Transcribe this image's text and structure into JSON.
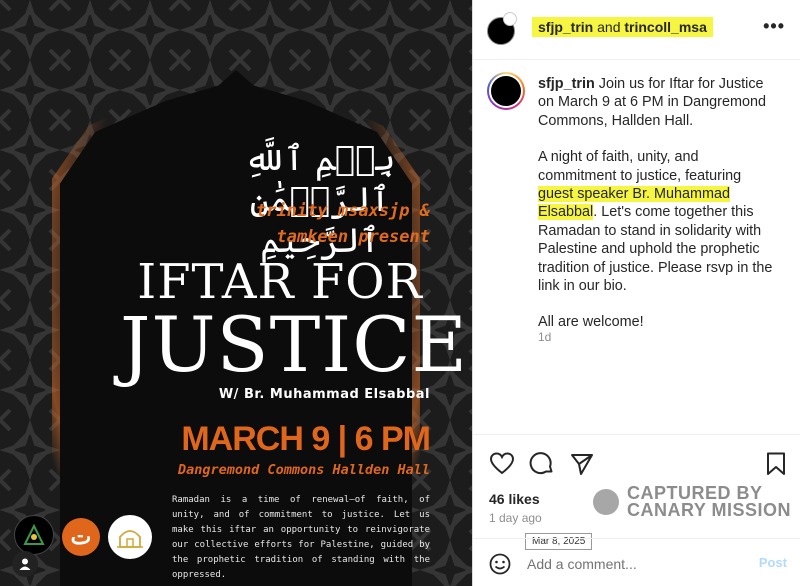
{
  "poster": {
    "bismillah": "بِسۡمِ ٱللَّهِ ٱلرَّحۡمَٰنِ ٱلرَّحِيمِ",
    "presenters_line1": "trinity msaxsjp &",
    "presenters_line2": "tamkeen present",
    "title_line1": "IFTAR FOR",
    "title_line2": "JUSTICE",
    "speaker": "W/ Br. Muhammad Elsabbal",
    "datetime": "MARCH 9 | 6 PM",
    "venue": "Dangremond Commons Hallden Hall",
    "description": "Ramadan is a time of renewal—of faith, of unity, and of commitment to justice. Let us make this iftar an opportunity to reinvigorate our collective efforts for Palestine, guided by the prophetic tradition of standing with the oppressed.",
    "logo_tamkeen_glyph": "ت",
    "colors": {
      "accent": "#e0661c",
      "background": "#1c1c1c"
    }
  },
  "header": {
    "user1": "sfjp_trin",
    "joiner": "and",
    "user2": "trincoll_msa",
    "more_label": "•••"
  },
  "caption": {
    "username": "sfjp_trin",
    "para1": "Join us for Iftar for Justice on March 9 at 6 PM in Dangremond Commons, Hallden Hall.",
    "para2_before": "A night of faith, unity, and commitment to justice, featuring ",
    "para2_highlight": "guest speaker Br. Muhammad Elsabbal",
    "para2_after": ". Let's come together this Ramadan to stand in solidarity with Palestine and uphold the prophetic tradition of justice. Please rsvp in the link in our bio.",
    "para3": "All are welcome!",
    "age": "1d"
  },
  "engagement": {
    "likes": "46 likes",
    "time_ago": "1 day ago",
    "tooltip": "Mar 8, 2025"
  },
  "watermark": {
    "line1": "CAPTURED BY",
    "line2": "CANARY MISSION"
  },
  "comment": {
    "placeholder": "Add a comment...",
    "post_label": "Post"
  }
}
